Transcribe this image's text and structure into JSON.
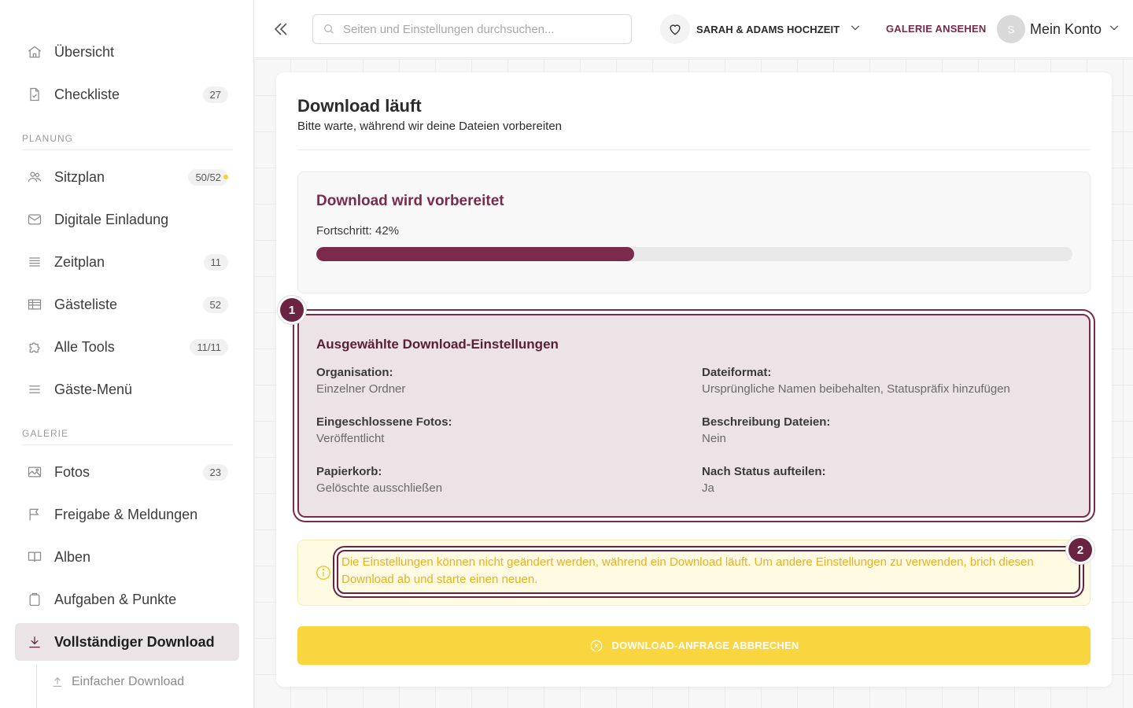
{
  "sidebar": {
    "items": [
      {
        "label": "Übersicht",
        "icon": "home-icon"
      },
      {
        "label": "Checkliste",
        "badge": "27",
        "icon": "checklist-icon"
      }
    ],
    "sections": [
      {
        "title": "PLANUNG",
        "items": [
          {
            "label": "Sitzplan",
            "badge": "50/52",
            "icon": "people-icon"
          },
          {
            "label": "Digitale Einladung",
            "icon": "mail-icon"
          },
          {
            "label": "Zeitplan",
            "badge": "11",
            "icon": "timeline-icon"
          },
          {
            "label": "Gästeliste",
            "badge": "52",
            "icon": "table-icon"
          },
          {
            "label": "Alle Tools",
            "badge": "11/11",
            "icon": "puzzle-icon"
          },
          {
            "label": "Gäste-Menü",
            "icon": "menu-icon"
          }
        ]
      },
      {
        "title": "GALERIE",
        "items": [
          {
            "label": "Fotos",
            "badge": "23",
            "icon": "image-icon"
          },
          {
            "label": "Freigabe & Meldungen",
            "icon": "flag-icon"
          },
          {
            "label": "Alben",
            "icon": "book-icon"
          },
          {
            "label": "Aufgaben & Punkte",
            "icon": "clipboard-icon"
          },
          {
            "label": "Vollständiger Download",
            "icon": "download-icon",
            "active": true
          }
        ]
      }
    ],
    "sub_item": {
      "label": "Einfacher Download",
      "icon": "upload-icon"
    }
  },
  "header": {
    "search_placeholder": "Seiten und Einstellungen durchsuchen...",
    "event_name": "SARAH & ADAMS HOCHZEIT",
    "gallery_link": "GALERIE ANSEHEN",
    "avatar_initial": "S",
    "account_label": "Mein Konto"
  },
  "main": {
    "title": "Download läuft",
    "subtitle": "Bitte warte, während wir deine Dateien vorbereiten",
    "progress": {
      "title": "Download wird vorbereitet",
      "text": "Fortschritt: 42%",
      "value": 0.42
    },
    "settings": {
      "title": "Ausgewählte Download-Einstellungen",
      "fields": [
        {
          "key": "Organisation:",
          "value": "Einzelner Ordner"
        },
        {
          "key": "Dateiformat:",
          "value": "Ursprüngliche Namen beibehalten, Statuspräfix hinzufügen"
        },
        {
          "key": "Eingeschlossene Fotos:",
          "value": "Veröffentlicht"
        },
        {
          "key": "Beschreibung Dateien:",
          "value": "Nein"
        },
        {
          "key": "Papierkorb:",
          "value": "Gelöschte ausschließen"
        },
        {
          "key": "Nach Status aufteilen:",
          "value": "Ja"
        }
      ]
    },
    "warning": "Die Einstellungen können nicht geändert werden, während ein Download läuft. Um andere Einstellungen zu verwenden, brich diesen Download ab und starte einen neuen.",
    "cancel_button": "DOWNLOAD-ANFRAGE ABBRECHEN",
    "markers": [
      "1",
      "2"
    ]
  },
  "colors": {
    "accent": "#7a2a4a",
    "warning": "#f9d53f",
    "badge_dot": "#f5d33a"
  }
}
